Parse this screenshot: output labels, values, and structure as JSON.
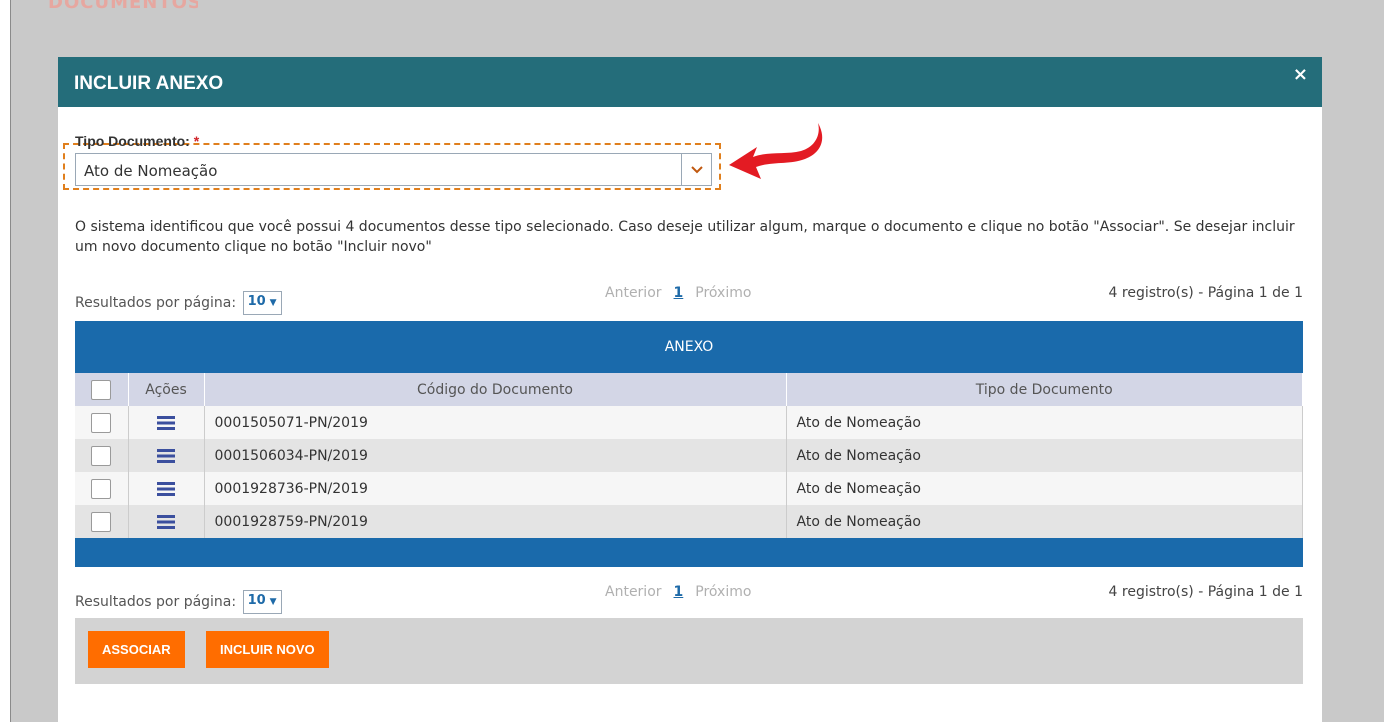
{
  "background": {
    "ghost_text": "DOCUMENTOS"
  },
  "modal": {
    "title": "INCLUIR ANEXO",
    "close_symbol": "×",
    "header_color": "#246d7a"
  },
  "form": {
    "label": "Tipo Documento:",
    "required_mark": "*",
    "select_value": "Ato de Nomeação",
    "highlight_color": "#e07f1d"
  },
  "info_text": "O sistema identificou que você possui 4 documentos desse tipo selecionado. Caso deseje utilizar algum, marque o documento e clique no botão \"Associar\". Se desejar incluir um novo documento clique no botão \"Incluir novo\"",
  "pagination": {
    "label": "Resultados por página:",
    "per_page": "10",
    "prev": "Anterior",
    "page": "1",
    "next": "Próximo",
    "summary": "4 registro(s) - Página 1 de 1"
  },
  "table": {
    "group_title": "ANEXO",
    "columns": [
      "",
      "Ações",
      "Código do Documento",
      "Tipo de Documento"
    ],
    "rows": [
      {
        "code": "0001505071-PN/2019",
        "type": "Ato de Nomeação"
      },
      {
        "code": "0001506034-PN/2019",
        "type": "Ato de Nomeação"
      },
      {
        "code": "0001928736-PN/2019",
        "type": "Ato de Nomeação"
      },
      {
        "code": "0001928759-PN/2019",
        "type": "Ato de Nomeação"
      }
    ],
    "band_color": "#1a6aab"
  },
  "buttons": {
    "associate": "ASSOCIAR",
    "new": "INCLUIR NOVO",
    "color": "#ff6d00"
  },
  "icons": [
    "close-icon",
    "chevron-down-icon",
    "menu-icon",
    "red-arrow-annotation",
    "caret-down-icon"
  ]
}
